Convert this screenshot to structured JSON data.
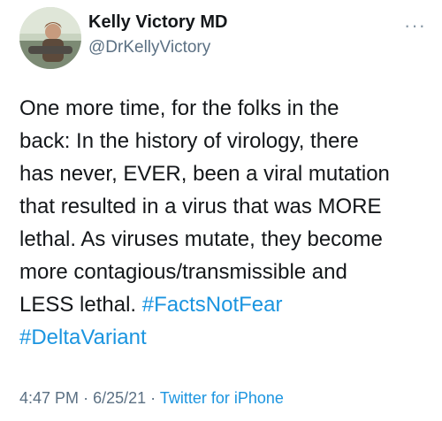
{
  "author": {
    "name": "Kelly Victory MD",
    "handle": "@DrKellyVictory"
  },
  "tweet": {
    "text_lines": [
      "One more time, for the folks in the",
      "back: In the history of virology, there",
      "has never, EVER, been a viral mutation",
      "that resulted in a virus that was MORE",
      "lethal. As viruses mutate, they become",
      "more contagious/transmissible and",
      "LESS lethal."
    ],
    "hashtags": [
      "#FactsNotFear",
      "#DeltaVariant"
    ]
  },
  "meta": {
    "time": "4:47 PM",
    "separator": "·",
    "date": "6/25/21",
    "source": "Twitter for iPhone"
  },
  "icons": {
    "more": "more-horizontal-icon"
  },
  "colors": {
    "hashtag": "#1b95e0",
    "secondary_text": "#5b7083"
  }
}
